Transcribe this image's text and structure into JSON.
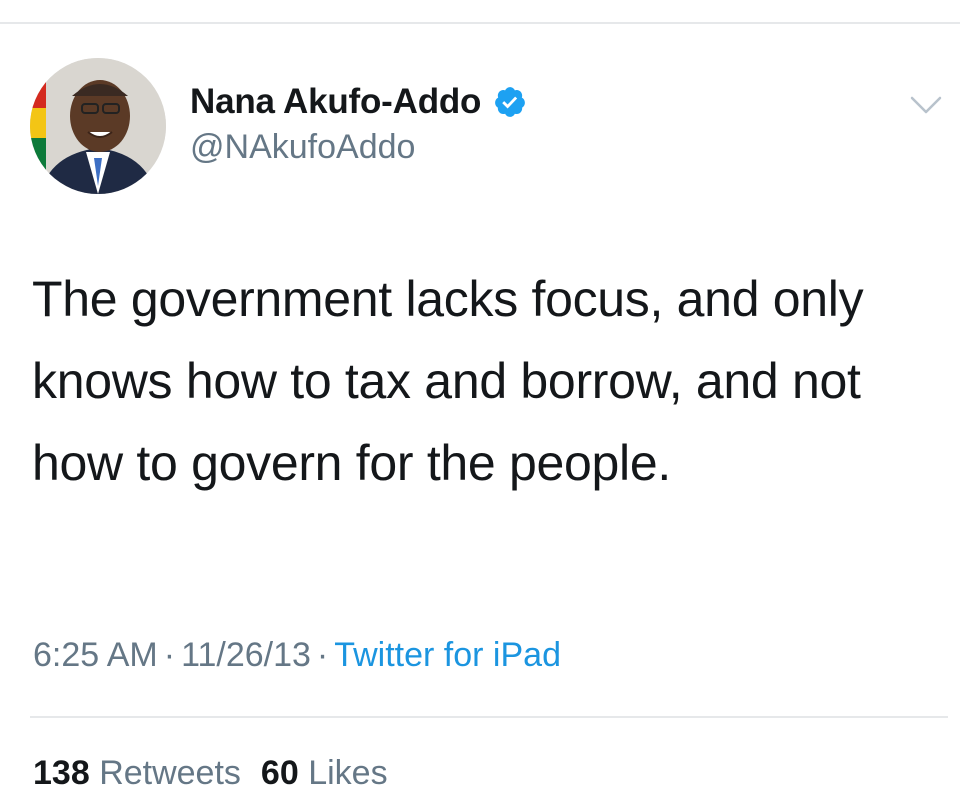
{
  "tweet": {
    "author": {
      "display_name": "Nana Akufo-Addo",
      "handle": "@NAkufoAddo",
      "verified": true,
      "avatar_icon": "profile-photo"
    },
    "text": "The government lacks focus, and only knows how to tax and borrow, and not how to govern for the people.",
    "time": "6:25 AM",
    "date": "11/26/13",
    "separator": "·",
    "source": "Twitter for iPad",
    "stats": {
      "retweets_count": "138",
      "retweets_label": "Retweets",
      "likes_count": "60",
      "likes_label": "Likes"
    }
  },
  "colors": {
    "primary_text": "#14171a",
    "secondary_text": "#657786",
    "link": "#1b95e0",
    "verified_badge": "#1da1f2",
    "divider": "#e6e8ea"
  },
  "icons": {
    "verified": "verified-badge-icon",
    "menu": "chevron-down-icon"
  }
}
